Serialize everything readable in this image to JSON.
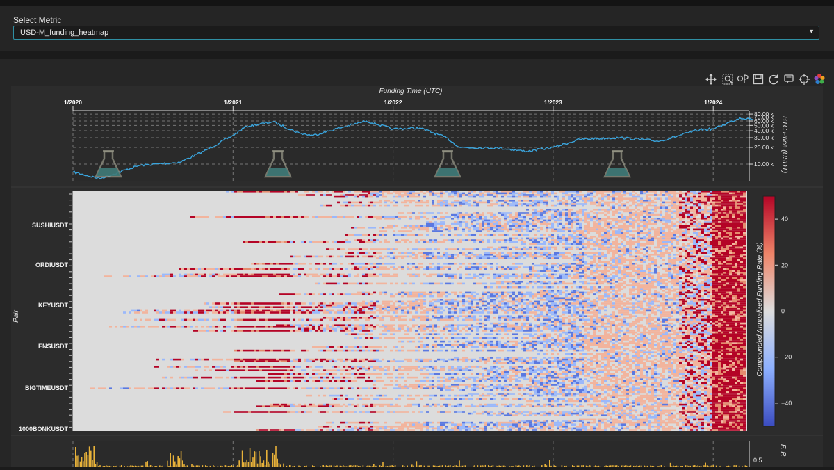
{
  "metric": {
    "label": "Select Metric",
    "selected": "USD-M_funding_heatmap"
  },
  "toolbar": {
    "tools": [
      "pan-icon",
      "box-zoom-icon",
      "wheel-zoom-icon",
      "save-icon",
      "reset-icon",
      "hover-icon",
      "crosshair-icon",
      "bokeh-logo-icon"
    ]
  },
  "price_chart": {
    "title": "Funding Time (UTC)",
    "x_ticks": [
      "1/2020",
      "1/2021",
      "1/2022",
      "1/2023",
      "1/2024"
    ],
    "y_label": "BTC Price (USDT)",
    "y_ticks": [
      "80.00 k",
      "70.00 k",
      "60.00 k",
      "50.00 k",
      "40.00 k",
      "30.00 k",
      "20.00 k",
      "10.00 k"
    ],
    "line_color": "#3aa4dc"
  },
  "heatmap": {
    "y_label": "Pair",
    "pairs": [
      "SUSHIUSDT",
      "ORDIUSDT",
      "KEYUSDT",
      "ENSUSDT",
      "BIGTIMEUSDT",
      "1000BONKUSDT"
    ],
    "colorbar_label": "Compounded Annualized Funding Rate (%)",
    "colorbar_ticks": [
      "40",
      "20",
      "0",
      "−20",
      "−40"
    ],
    "colorbar_range": [
      -50,
      50
    ],
    "colors": {
      "high": "#b40426",
      "mid": "#dddddd",
      "low": "#3b4cc0"
    }
  },
  "bottom_chart": {
    "y_label": "F. R",
    "y_ticks": [
      "0.5"
    ],
    "bar_color": "#e8b23a"
  },
  "chart_data": {
    "type": "line",
    "title": "Funding Time (UTC)",
    "xlabel": "",
    "ylabel": "BTC Price (USDT)",
    "x": [
      "2020-01",
      "2020-03",
      "2020-06",
      "2020-09",
      "2020-11",
      "2021-01",
      "2021-02",
      "2021-04",
      "2021-06",
      "2021-07",
      "2021-09",
      "2021-11",
      "2022-01",
      "2022-03",
      "2022-05",
      "2022-06",
      "2022-09",
      "2022-11",
      "2023-01",
      "2023-03",
      "2023-06",
      "2023-09",
      "2023-12",
      "2024-01",
      "2024-03",
      "2024-04"
    ],
    "series": [
      {
        "values": [
          7200,
          5500,
          9500,
          10800,
          18000,
          33000,
          48000,
          58000,
          36000,
          33000,
          45000,
          60000,
          43000,
          45000,
          30000,
          20000,
          19500,
          17000,
          20000,
          28000,
          30000,
          26000,
          42000,
          43000,
          68000,
          65000
        ]
      }
    ],
    "y_scale": "log",
    "ylim": [
      5000,
      90000
    ]
  }
}
